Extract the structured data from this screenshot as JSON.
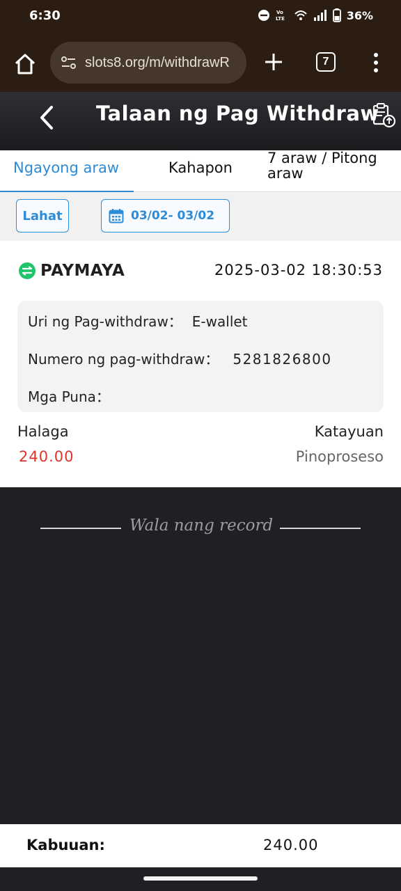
{
  "status_bar": {
    "time": "6:30",
    "battery": "36%",
    "icons": [
      "dnd-icon",
      "volte-icon",
      "wifi-icon",
      "signal-icon",
      "battery-icon"
    ]
  },
  "browser": {
    "url": "slots8.org/m/withdrawR",
    "tab_count": "7"
  },
  "header": {
    "title": "Talaan ng Pag Withdraw"
  },
  "tabs": [
    {
      "label": "Ngayong araw",
      "active": true
    },
    {
      "label": "Kahapon",
      "active": false
    },
    {
      "label": "7 araw / Pitong araw",
      "active": false
    }
  ],
  "filters": {
    "all_label": "Lahat",
    "date_range": "03/02- 03/02"
  },
  "record": {
    "provider": "PAYMAYA",
    "datetime": "2025-03-02 18:30:53",
    "type_label": "Uri ng Pag-withdraw：",
    "type_value": "E-wallet",
    "number_label": "Numero ng pag-withdraw：",
    "number_value": "5281826800",
    "remarks_label": "Mga Puna：",
    "amount_label": "Halaga",
    "amount_value": "240.00",
    "status_label": "Katayuan",
    "status_value": "Pinoproseso"
  },
  "empty_text": "Wala nang record",
  "footer": {
    "total_label": "Kabuuan:",
    "total_value": "240.00"
  },
  "colors": {
    "accent": "#2e8bd6",
    "amount": "#e0332a",
    "paymaya_green": "#1fc46b",
    "browser_bg": "#2b1d12",
    "page_bg": "#1f2023"
  }
}
